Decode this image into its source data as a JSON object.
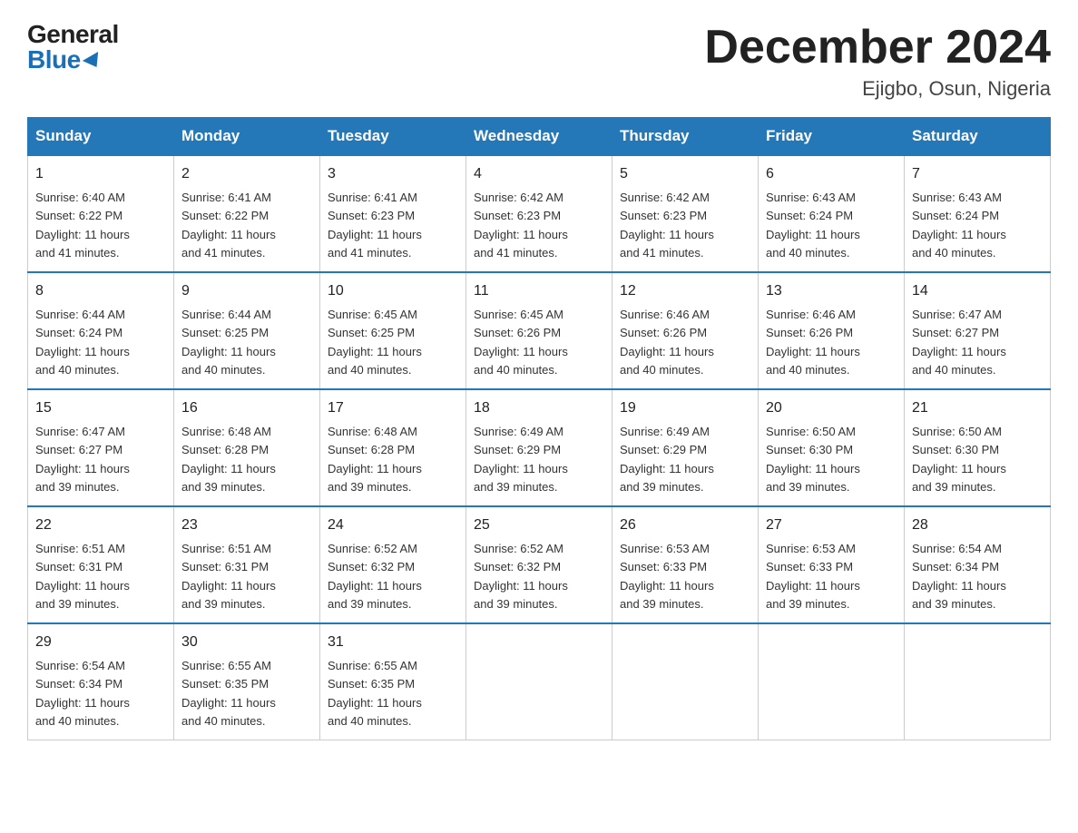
{
  "logo": {
    "general": "General",
    "blue": "Blue"
  },
  "title": "December 2024",
  "location": "Ejigbo, Osun, Nigeria",
  "days_of_week": [
    "Sunday",
    "Monday",
    "Tuesday",
    "Wednesday",
    "Thursday",
    "Friday",
    "Saturday"
  ],
  "weeks": [
    [
      {
        "day": "1",
        "sunrise": "6:40 AM",
        "sunset": "6:22 PM",
        "daylight": "11 hours and 41 minutes."
      },
      {
        "day": "2",
        "sunrise": "6:41 AM",
        "sunset": "6:22 PM",
        "daylight": "11 hours and 41 minutes."
      },
      {
        "day": "3",
        "sunrise": "6:41 AM",
        "sunset": "6:23 PM",
        "daylight": "11 hours and 41 minutes."
      },
      {
        "day": "4",
        "sunrise": "6:42 AM",
        "sunset": "6:23 PM",
        "daylight": "11 hours and 41 minutes."
      },
      {
        "day": "5",
        "sunrise": "6:42 AM",
        "sunset": "6:23 PM",
        "daylight": "11 hours and 41 minutes."
      },
      {
        "day": "6",
        "sunrise": "6:43 AM",
        "sunset": "6:24 PM",
        "daylight": "11 hours and 40 minutes."
      },
      {
        "day": "7",
        "sunrise": "6:43 AM",
        "sunset": "6:24 PM",
        "daylight": "11 hours and 40 minutes."
      }
    ],
    [
      {
        "day": "8",
        "sunrise": "6:44 AM",
        "sunset": "6:24 PM",
        "daylight": "11 hours and 40 minutes."
      },
      {
        "day": "9",
        "sunrise": "6:44 AM",
        "sunset": "6:25 PM",
        "daylight": "11 hours and 40 minutes."
      },
      {
        "day": "10",
        "sunrise": "6:45 AM",
        "sunset": "6:25 PM",
        "daylight": "11 hours and 40 minutes."
      },
      {
        "day": "11",
        "sunrise": "6:45 AM",
        "sunset": "6:26 PM",
        "daylight": "11 hours and 40 minutes."
      },
      {
        "day": "12",
        "sunrise": "6:46 AM",
        "sunset": "6:26 PM",
        "daylight": "11 hours and 40 minutes."
      },
      {
        "day": "13",
        "sunrise": "6:46 AM",
        "sunset": "6:26 PM",
        "daylight": "11 hours and 40 minutes."
      },
      {
        "day": "14",
        "sunrise": "6:47 AM",
        "sunset": "6:27 PM",
        "daylight": "11 hours and 40 minutes."
      }
    ],
    [
      {
        "day": "15",
        "sunrise": "6:47 AM",
        "sunset": "6:27 PM",
        "daylight": "11 hours and 39 minutes."
      },
      {
        "day": "16",
        "sunrise": "6:48 AM",
        "sunset": "6:28 PM",
        "daylight": "11 hours and 39 minutes."
      },
      {
        "day": "17",
        "sunrise": "6:48 AM",
        "sunset": "6:28 PM",
        "daylight": "11 hours and 39 minutes."
      },
      {
        "day": "18",
        "sunrise": "6:49 AM",
        "sunset": "6:29 PM",
        "daylight": "11 hours and 39 minutes."
      },
      {
        "day": "19",
        "sunrise": "6:49 AM",
        "sunset": "6:29 PM",
        "daylight": "11 hours and 39 minutes."
      },
      {
        "day": "20",
        "sunrise": "6:50 AM",
        "sunset": "6:30 PM",
        "daylight": "11 hours and 39 minutes."
      },
      {
        "day": "21",
        "sunrise": "6:50 AM",
        "sunset": "6:30 PM",
        "daylight": "11 hours and 39 minutes."
      }
    ],
    [
      {
        "day": "22",
        "sunrise": "6:51 AM",
        "sunset": "6:31 PM",
        "daylight": "11 hours and 39 minutes."
      },
      {
        "day": "23",
        "sunrise": "6:51 AM",
        "sunset": "6:31 PM",
        "daylight": "11 hours and 39 minutes."
      },
      {
        "day": "24",
        "sunrise": "6:52 AM",
        "sunset": "6:32 PM",
        "daylight": "11 hours and 39 minutes."
      },
      {
        "day": "25",
        "sunrise": "6:52 AM",
        "sunset": "6:32 PM",
        "daylight": "11 hours and 39 minutes."
      },
      {
        "day": "26",
        "sunrise": "6:53 AM",
        "sunset": "6:33 PM",
        "daylight": "11 hours and 39 minutes."
      },
      {
        "day": "27",
        "sunrise": "6:53 AM",
        "sunset": "6:33 PM",
        "daylight": "11 hours and 39 minutes."
      },
      {
        "day": "28",
        "sunrise": "6:54 AM",
        "sunset": "6:34 PM",
        "daylight": "11 hours and 39 minutes."
      }
    ],
    [
      {
        "day": "29",
        "sunrise": "6:54 AM",
        "sunset": "6:34 PM",
        "daylight": "11 hours and 40 minutes."
      },
      {
        "day": "30",
        "sunrise": "6:55 AM",
        "sunset": "6:35 PM",
        "daylight": "11 hours and 40 minutes."
      },
      {
        "day": "31",
        "sunrise": "6:55 AM",
        "sunset": "6:35 PM",
        "daylight": "11 hours and 40 minutes."
      },
      null,
      null,
      null,
      null
    ]
  ],
  "labels": {
    "sunrise": "Sunrise:",
    "sunset": "Sunset:",
    "daylight": "Daylight:"
  }
}
